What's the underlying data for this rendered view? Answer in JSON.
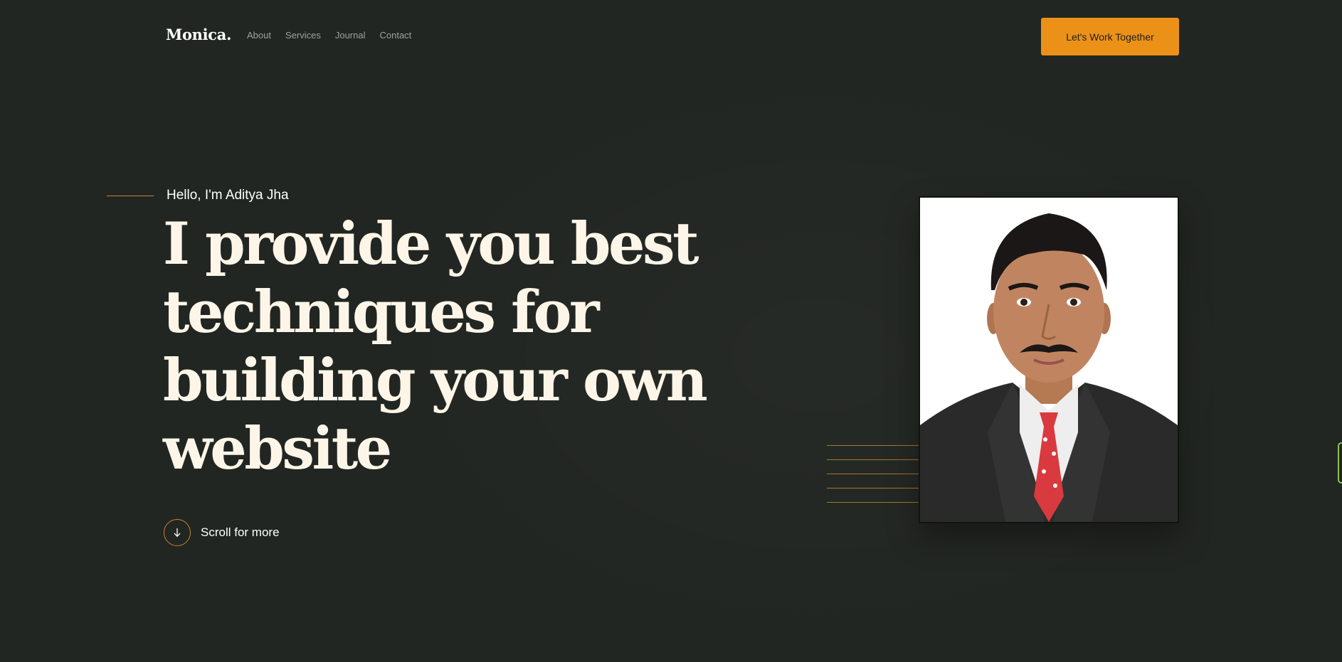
{
  "brand": {
    "logo": "Monica."
  },
  "nav": {
    "items": [
      {
        "label": "About"
      },
      {
        "label": "Services"
      },
      {
        "label": "Journal"
      },
      {
        "label": "Contact"
      }
    ],
    "cta_label": "Let's Work Together"
  },
  "hero": {
    "greeting": "Hello, I'm Aditya Jha",
    "headline_lines": [
      "I provide you best",
      "techniques for",
      "building your own",
      "website"
    ],
    "scroll_label": "Scroll for more"
  },
  "colors": {
    "background": "#222622",
    "accent": "#ec9118",
    "heading": "#fdf6e8",
    "nav_text": "#9ea19b"
  },
  "icons": {
    "scroll": "arrow-down-icon"
  }
}
